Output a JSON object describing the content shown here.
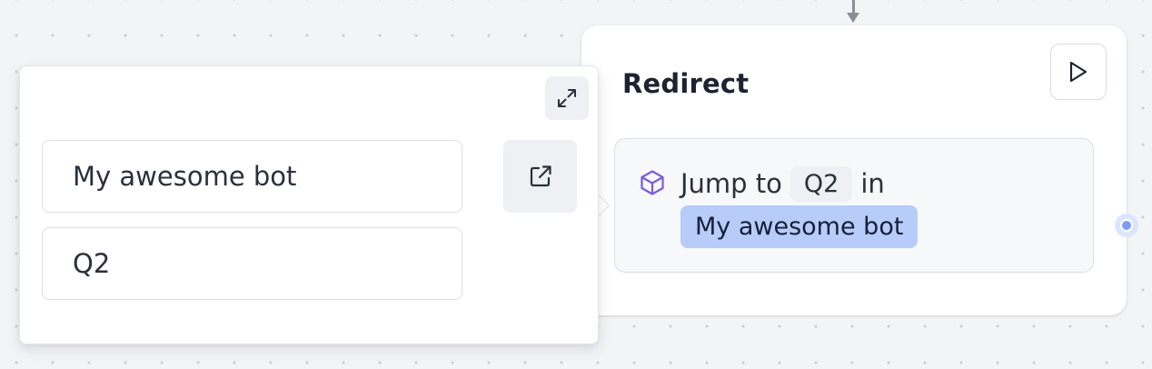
{
  "block": {
    "title": "Redirect",
    "run_button_icon": "play-icon",
    "step": {
      "type_icon": "cube-icon",
      "prefix": "Jump to",
      "group": "Q2",
      "connector": "in",
      "bot": "My awesome bot"
    }
  },
  "settings": {
    "expand_icon": "expand-icon",
    "bot_input": {
      "value": "My awesome bot"
    },
    "group_input": {
      "value": "Q2"
    },
    "open_bot_icon": "external-link-icon"
  },
  "colors": {
    "accent": "#7e9bf5",
    "chip_blue": "#b8ccf9",
    "cube_icon": "#7c5cd6",
    "canvas": "#f3f4f6"
  }
}
